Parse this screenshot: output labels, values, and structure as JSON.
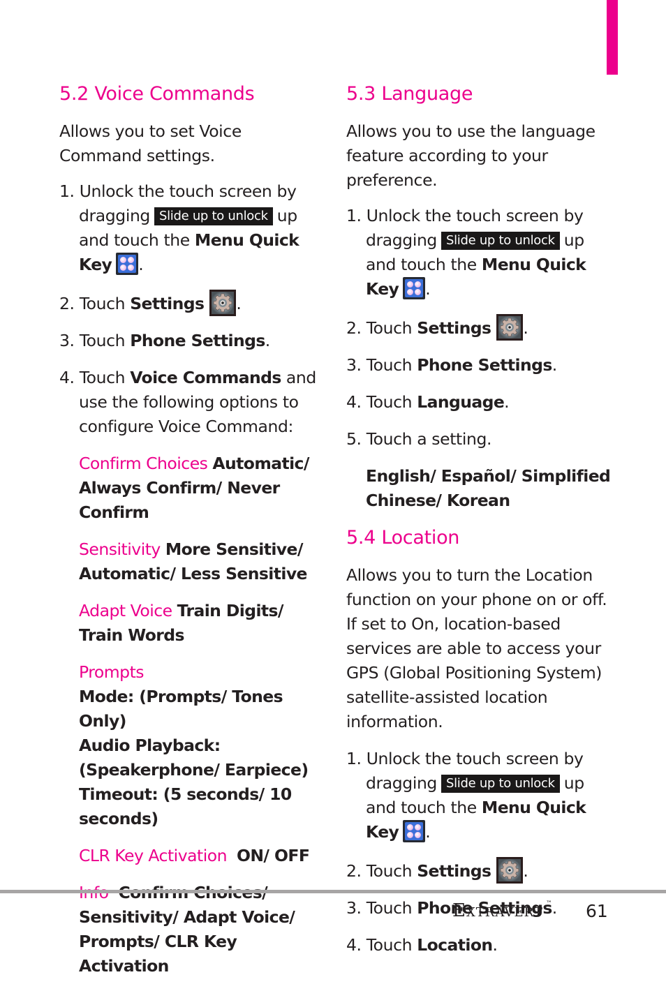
{
  "colors": {
    "accent": "#ec008c",
    "text": "#231f20",
    "rule": "#a7a5a5"
  },
  "voice_commands": {
    "heading": "5.2 Voice Commands",
    "intro": "Allows you to set Voice Command settings.",
    "steps": [
      {
        "num": "1.",
        "pre": "Unlock the touch screen by dragging",
        "badge": "Slide up to unlock",
        "mid": "up and touch the",
        "bold": "Menu Quick Key",
        "icon": "menu-quick-key-icon",
        "post": "."
      },
      {
        "num": "2.",
        "pre": "Touch",
        "bold": "Settings",
        "icon": "settings-gear-icon",
        "post": "."
      },
      {
        "num": "3.",
        "pre": "Touch",
        "bold": "Phone Settings",
        "post": "."
      },
      {
        "num": "4.",
        "pre": "Touch",
        "bold": "Voice Commands",
        "post": "and use the following options to configure Voice Command:"
      }
    ],
    "options": [
      {
        "label": "Confirm Choices",
        "value": "Automatic/ Always Confirm/ Never Confirm"
      },
      {
        "label": "Sensitivity",
        "value": "More Sensitive/ Automatic/ Less Sensitive"
      },
      {
        "label": "Adapt Voice",
        "value": "Train Digits/ Train Words"
      },
      {
        "label": "Prompts",
        "lines": [
          "Mode: (Prompts/ Tones Only)",
          "Audio Playback: (Speakerphone/ Earpiece)",
          "Timeout: (5 seconds/ 10 seconds)"
        ]
      },
      {
        "label": "CLR Key Activation",
        "value": "ON/ OFF"
      },
      {
        "label": "Info",
        "value": "Confirm Choices/ Sensitivity/ Adapt Voice/ Prompts/ CLR Key Activation"
      }
    ]
  },
  "language": {
    "heading": "5.3 Language",
    "intro": "Allows you to use the language feature according to your preference.",
    "steps": [
      {
        "num": "1.",
        "pre": "Unlock the touch screen by dragging",
        "badge": "Slide up to unlock",
        "mid": "up and touch the",
        "bold": "Menu Quick Key",
        "icon": "menu-quick-key-icon",
        "post": "."
      },
      {
        "num": "2.",
        "pre": "Touch",
        "bold": "Settings",
        "icon": "settings-gear-icon",
        "post": "."
      },
      {
        "num": "3.",
        "pre": "Touch",
        "bold": "Phone Settings",
        "post": "."
      },
      {
        "num": "4.",
        "pre": "Touch",
        "bold": "Language",
        "post": "."
      },
      {
        "num": "5.",
        "pre": "Touch a setting.",
        "post": ""
      }
    ],
    "choices": "English/ Español/ Simplified Chinese/ Korean"
  },
  "location": {
    "heading": "5.4 Location",
    "intro": "Allows you to turn the Location function on your phone on or off. If set to On, location-based services are able to access your GPS (Global Positioning System) satellite-assisted location information.",
    "steps": [
      {
        "num": "1.",
        "pre": "Unlock the touch screen by dragging",
        "badge": "Slide up to unlock",
        "mid": "up and touch the",
        "bold": "Menu Quick Key",
        "icon": "menu-quick-key-icon",
        "post": "."
      },
      {
        "num": "2.",
        "pre": "Touch",
        "bold": "Settings",
        "icon": "settings-gear-icon",
        "post": "."
      },
      {
        "num": "3.",
        "pre": "Touch",
        "bold": "Phone Settings",
        "post": "."
      },
      {
        "num": "4.",
        "pre": "Touch",
        "bold": "Location",
        "post": "."
      }
    ]
  },
  "footer": {
    "brand": "Extravert",
    "trademark": "™",
    "page_number": "61"
  }
}
